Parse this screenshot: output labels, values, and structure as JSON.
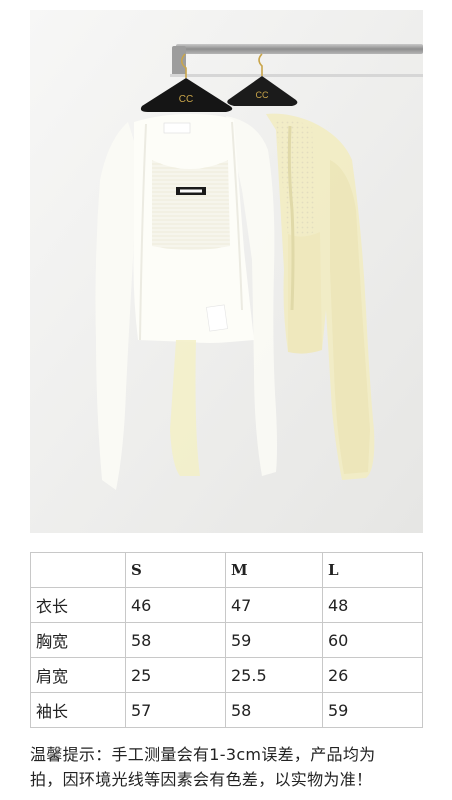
{
  "photo": {
    "hanger_logo": "CC",
    "garments": [
      "white-cardigan-set",
      "cream-cardigan-set"
    ],
    "colors": {
      "background": "#f0f0ef",
      "white_knit": "#fbfbf5",
      "cream_knit": "#f1ecc4",
      "rail": "#8e8e8e"
    }
  },
  "size_table": {
    "headers": [
      "",
      "S",
      "M",
      "L"
    ],
    "rows": [
      {
        "label": "衣长",
        "values": [
          "46",
          "47",
          "48"
        ]
      },
      {
        "label": "胸宽",
        "values": [
          "58",
          "59",
          "60"
        ]
      },
      {
        "label": "肩宽",
        "values": [
          "25",
          "25.5",
          "26"
        ]
      },
      {
        "label": "袖长",
        "values": [
          "57",
          "58",
          "59"
        ]
      }
    ]
  },
  "note": {
    "line1": "温馨提示：手工测量会有1-3cm误差，产品均为",
    "line2": "拍，因环境光线等因素会有色差，以实物为准！"
  }
}
